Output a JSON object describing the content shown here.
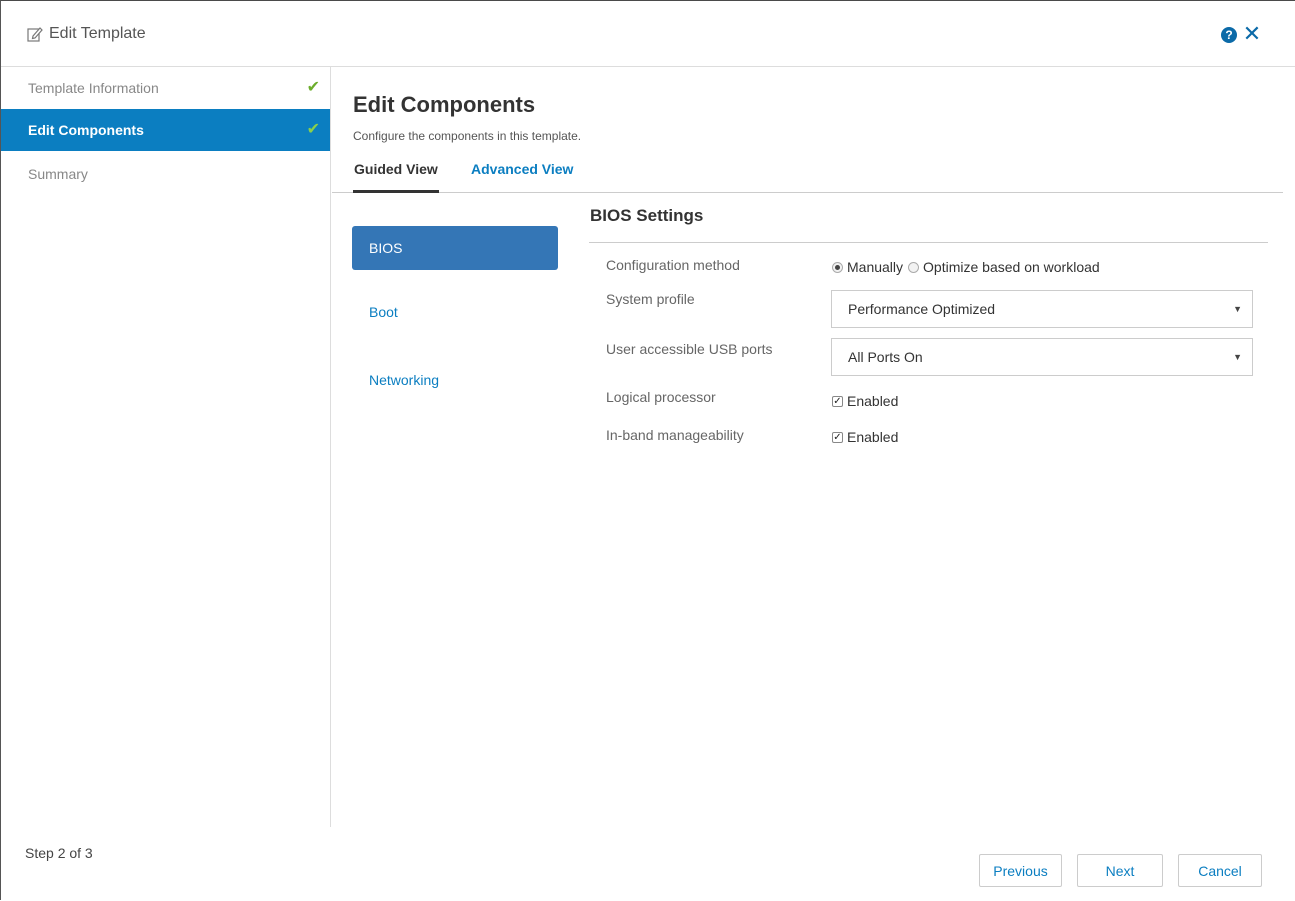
{
  "header": {
    "title": "Edit Template",
    "help_icon": "?",
    "close_icon": "✕"
  },
  "sidebar": {
    "steps": [
      {
        "label": "Template Information",
        "completed": true
      },
      {
        "label": "Edit Components",
        "completed": true,
        "active": true
      },
      {
        "label": "Summary",
        "completed": false
      }
    ],
    "check_glyph": "✔"
  },
  "main": {
    "title": "Edit Components",
    "subtitle": "Configure the components in this template.",
    "tabs": [
      {
        "label": "Guided View",
        "selected": true
      },
      {
        "label": "Advanced View",
        "selected": false
      }
    ],
    "components": [
      "BIOS",
      "Boot",
      "Networking"
    ],
    "section_title": "BIOS Settings",
    "fields": {
      "config_method": {
        "label": "Configuration method",
        "options": [
          "Manually",
          "Optimize based on workload"
        ],
        "selected": "Manually"
      },
      "system_profile": {
        "label": "System profile",
        "value": "Performance Optimized"
      },
      "usb_ports": {
        "label": "User accessible USB ports",
        "value": "All Ports On"
      },
      "logical_processor": {
        "label": "Logical processor",
        "checkbox_label": "Enabled",
        "checked": true
      },
      "inband_manageability": {
        "label": "In-band manageability",
        "checkbox_label": "Enabled",
        "checked": true
      }
    }
  },
  "footer": {
    "step_text": "Step 2 of 3",
    "previous_label": "Previous",
    "next_label": "Next",
    "cancel_label": "Cancel"
  },
  "colors": {
    "accent": "#0b7ec1",
    "active_component": "#3476b6",
    "check_green": "#6cad2c"
  }
}
